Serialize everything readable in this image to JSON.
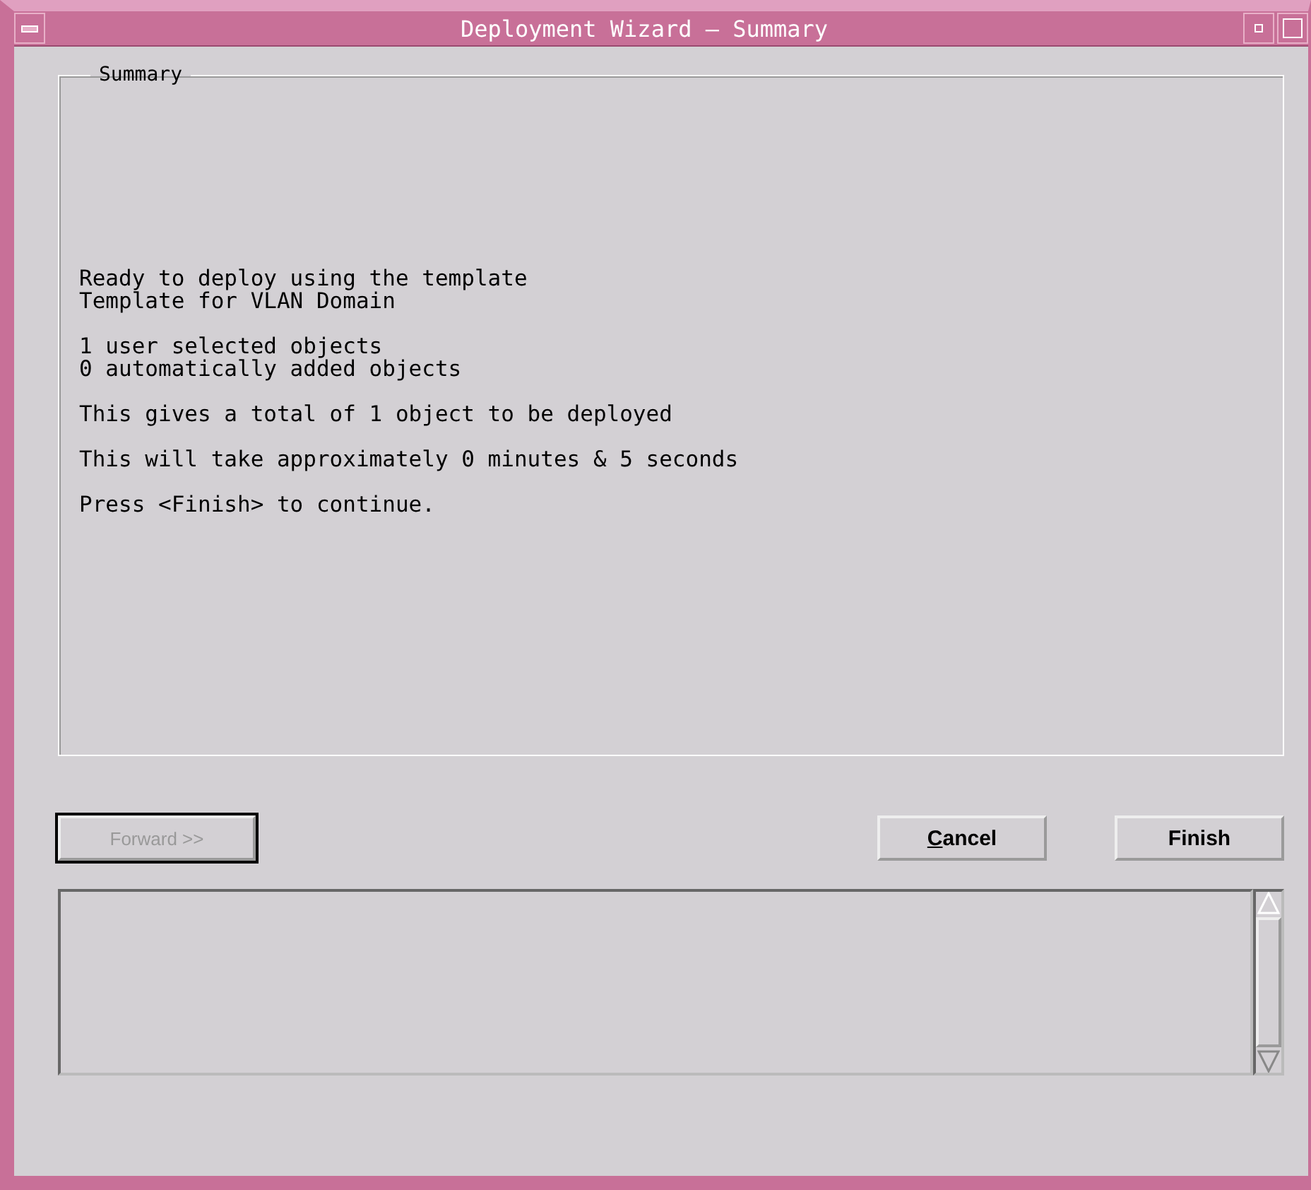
{
  "window": {
    "title": "Deployment Wizard — Summary"
  },
  "summary": {
    "legend": "Summary",
    "paragraphs": [
      [
        "Ready to deploy using the template",
        "Template for VLAN Domain"
      ],
      [
        "1 user selected objects",
        "0 automatically added objects"
      ],
      [
        "This gives a total of 1 object to be deployed"
      ],
      [
        "This will take approximately 0 minutes & 5 seconds"
      ],
      [
        "Press <Finish> to continue."
      ]
    ]
  },
  "buttons": [
    {
      "label": "Forward >>",
      "disabled": true,
      "focused": true,
      "mnemonic": false
    },
    {
      "label": "Cancel",
      "disabled": false,
      "focused": false,
      "mnemonic": true
    },
    {
      "label": "Finish",
      "disabled": false,
      "focused": false,
      "mnemonic": false
    }
  ]
}
